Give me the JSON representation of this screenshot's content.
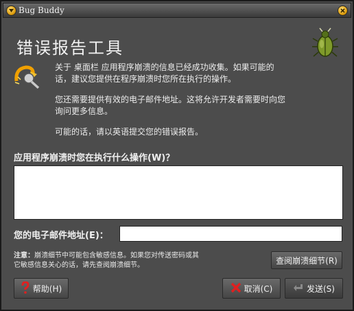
{
  "window": {
    "title": "Bug Buddy"
  },
  "header": {
    "heading": "错误报告工具"
  },
  "intro": {
    "paragraph1_line1": "关于 桌面栏 应用程序崩溃的信息已经成功收集。如果可能的",
    "paragraph1_line2": "话，建议您提供在程序崩溃时您所在执行的操作。",
    "paragraph2_line1": "您还需要提供有效的电子邮件地址。这将允许开发者需要时向您",
    "paragraph2_line2": "询问更多信息。",
    "paragraph3": "可能的话，请以英语提交您的错误报告。"
  },
  "form": {
    "what_label": "应用程序崩溃时您在执行什么操作(W)？",
    "what_value": "",
    "email_label": "您的电子邮件地址(E)：",
    "email_value": ""
  },
  "note": {
    "prefix": "注意：",
    "line1": "崩溃细节中可能包含敏感信息。如果您对传送密码或其",
    "line2": "它敏感信息关心的话，请先查阅崩溃细节。"
  },
  "buttons": {
    "details": "查阅崩溃细节(R)",
    "help": "帮助(H)",
    "cancel": "取消(C)",
    "send": "发送(S)"
  },
  "icons": {
    "menu": "window-menu-icon",
    "close": "window-close-icon",
    "bug": "bug-icon",
    "crash": "crash-icon",
    "help": "help-icon",
    "cancel": "cancel-icon",
    "send": "send-icon"
  }
}
